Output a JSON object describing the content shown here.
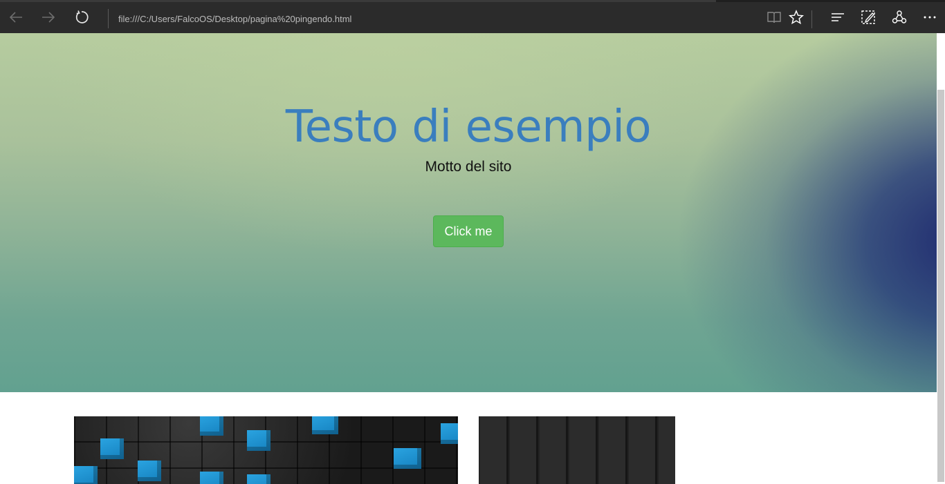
{
  "browser": {
    "address": "file:///C:/Users/FalcoOS/Desktop/pagina%20pingendo.html",
    "icons": {
      "back": "arrow-left-icon",
      "forward": "arrow-right-icon",
      "refresh": "refresh-icon",
      "reading_view": "book-icon",
      "favorites": "star-icon",
      "hub": "hub-lines-icon",
      "web_note": "pen-note-icon",
      "share": "share-icon",
      "more": "more-dots-icon"
    }
  },
  "hero": {
    "title": "Testo di esempio",
    "motto": "Motto del sito",
    "button_label": "Click me"
  },
  "colors": {
    "title": "#3a7ebe",
    "button": "#5cb85c",
    "toolbar": "#2b2b2b"
  }
}
